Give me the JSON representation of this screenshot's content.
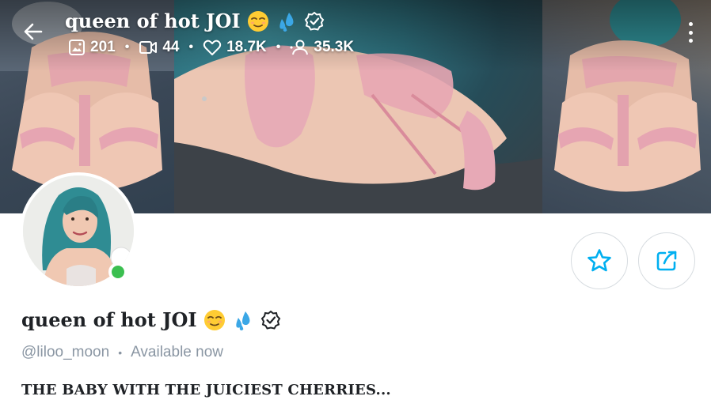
{
  "header": {
    "title": "queen of hot JOI",
    "back_icon": "arrow-left-icon",
    "more_icon": "more-vertical-icon",
    "title_emojis": [
      "relieved-face-icon",
      "sweat-droplets-icon"
    ],
    "verified_icon": "verified-badge-icon"
  },
  "stats": {
    "photos": {
      "icon": "image-icon",
      "value": "201"
    },
    "videos": {
      "icon": "video-icon",
      "value": "44"
    },
    "likes": {
      "icon": "heart-icon",
      "value": "18.7K"
    },
    "fans": {
      "icon": "fans-icon",
      "value": "35.3K"
    },
    "separator": "•"
  },
  "profile": {
    "name": "queen of hot JOI",
    "handle": "@liloo_moon",
    "separator": "•",
    "status": "Available now",
    "bio": "THE BABY WITH THE JUICIEST CHERRIES...",
    "online": true
  },
  "actions": {
    "favorite_icon": "star-outline-icon",
    "share_icon": "share-icon"
  },
  "colors": {
    "accent": "#00aff0",
    "online": "#3bbf50",
    "muted_text": "#8a96a3",
    "body_text": "#1f2226"
  }
}
